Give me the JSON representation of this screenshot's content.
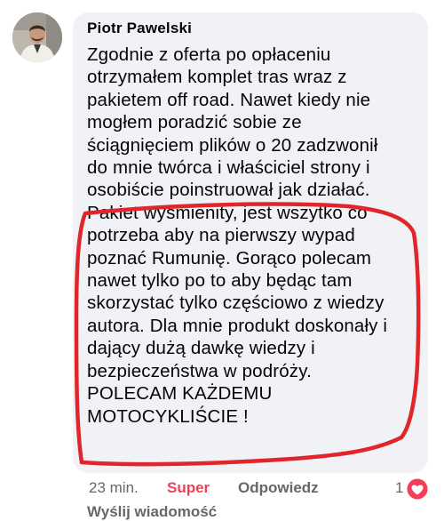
{
  "comment": {
    "author": "Piotr Pawelski",
    "lines": [
      "Zgodnie z oferta po opłaceniu",
      "otrzymałem komplet tras wraz z",
      "pakietem off road. Nawet kiedy nie",
      "mogłem poradzić sobie ze",
      "ściągnięciem plików o 20 zadzwonił",
      "do mnie twórca i właściciel strony i",
      "osobiście poinstruował jak działać.",
      "Pakiet wyśmienity, jest wszytko co",
      "potrzeba aby na pierwszy wypad",
      "poznać Rumunię. Gorąco polecam",
      "nawet tylko po to aby będąc tam",
      "skorzystać tylko częściowo z wiedzy",
      "autora. Dla mnie produkt doskonały i",
      "dający dużą dawkę wiedzy i",
      "bezpieczeństwa w podróży.",
      "POLECAM KAŻDEMU",
      "MOTOCYKLIŚCIE !"
    ]
  },
  "actions": {
    "time": "23 min.",
    "like_label": "Super",
    "reply_label": "Odpowiedz",
    "reaction_count": "1"
  },
  "footer": {
    "send_message": "Wyślij wiadomość"
  },
  "icons": {
    "avatar": "profile-photo",
    "reaction": "love-reaction-icon"
  },
  "colors": {
    "bubble": "#f0f2f5",
    "text": "#050505",
    "meta": "#65676b",
    "like_active": "#f33e58",
    "highlight": "#e0252b"
  }
}
